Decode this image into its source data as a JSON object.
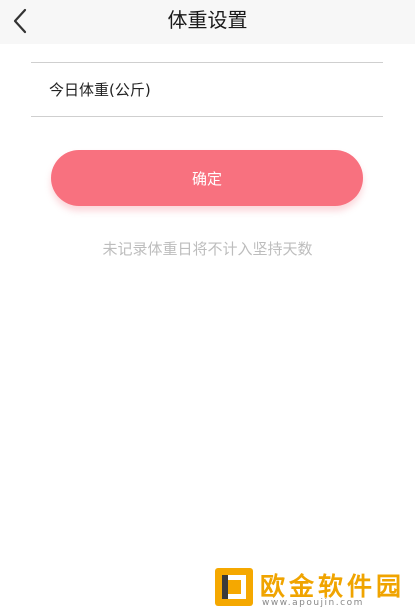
{
  "header": {
    "title": "体重设置",
    "back_icon": "chevron-left-icon"
  },
  "form": {
    "weight_placeholder": "今日体重(公斤)",
    "weight_value": ""
  },
  "actions": {
    "confirm_label": "确定"
  },
  "hint": {
    "text": "未记录体重日将不计入坚持天数"
  },
  "watermark": {
    "name": "欧金软件园",
    "url": "www.apoujin.com"
  },
  "colors": {
    "accent": "#f8717f",
    "hint_text": "#bdbdbd",
    "header_bg": "#f7f7f7",
    "watermark": "#f0a400"
  }
}
